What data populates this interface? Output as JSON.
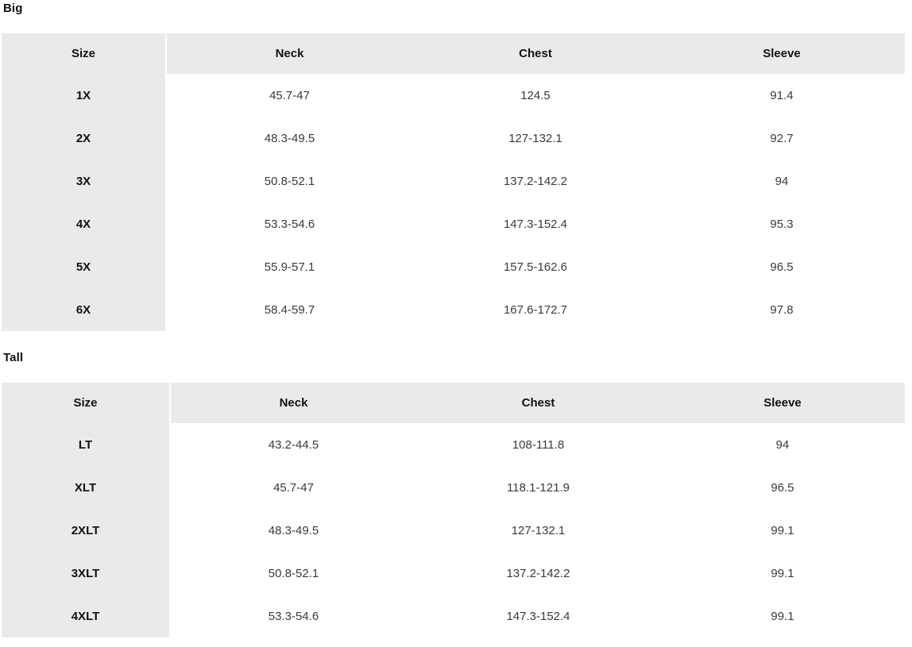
{
  "sections": [
    {
      "title": "Big",
      "columns": [
        "Size",
        "Neck",
        "Chest",
        "Sleeve"
      ],
      "rows": [
        {
          "size": "1X",
          "neck": "45.7-47",
          "chest": "124.5",
          "sleeve": "91.4"
        },
        {
          "size": "2X",
          "neck": "48.3-49.5",
          "chest": "127-132.1",
          "sleeve": "92.7"
        },
        {
          "size": "3X",
          "neck": "50.8-52.1",
          "chest": "137.2-142.2",
          "sleeve": "94"
        },
        {
          "size": "4X",
          "neck": "53.3-54.6",
          "chest": "147.3-152.4",
          "sleeve": "95.3"
        },
        {
          "size": "5X",
          "neck": "55.9-57.1",
          "chest": "157.5-162.6",
          "sleeve": "96.5"
        },
        {
          "size": "6X",
          "neck": "58.4-59.7",
          "chest": "167.6-172.7",
          "sleeve": "97.8"
        }
      ]
    },
    {
      "title": "Tall",
      "columns": [
        "Size",
        "Neck",
        "Chest",
        "Sleeve"
      ],
      "rows": [
        {
          "size": "LT",
          "neck": "43.2-44.5",
          "chest": "108-111.8",
          "sleeve": "94"
        },
        {
          "size": "XLT",
          "neck": "45.7-47",
          "chest": "118.1-121.9",
          "sleeve": "96.5"
        },
        {
          "size": "2XLT",
          "neck": "48.3-49.5",
          "chest": "127-132.1",
          "sleeve": "99.1"
        },
        {
          "size": "3XLT",
          "neck": "50.8-52.1",
          "chest": "137.2-142.2",
          "sleeve": "99.1"
        },
        {
          "size": "4XLT",
          "neck": "53.3-54.6",
          "chest": "147.3-152.4",
          "sleeve": "99.1"
        }
      ]
    }
  ],
  "colors": {
    "header_background": "#e9eaec",
    "size_column_background": "#e9eaec",
    "cell_background": "#ffffff",
    "header_text": "#121212",
    "cell_text": "#3a3a3a",
    "divider": "#ffffff"
  }
}
